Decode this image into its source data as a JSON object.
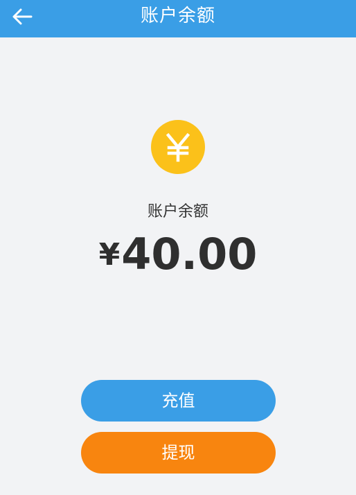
{
  "header": {
    "title": "账户余额",
    "back_icon": "arrow-left-icon",
    "background": "#3a9ee6"
  },
  "balance": {
    "icon": "yuan-coin-icon",
    "icon_color": "#fbc11a",
    "icon_symbol": "¥",
    "label": "账户余额",
    "currency": "¥",
    "amount": "40.00"
  },
  "actions": {
    "recharge_label": "充值",
    "recharge_color": "#3a9ee6",
    "withdraw_label": "提现",
    "withdraw_color": "#f8850f"
  }
}
